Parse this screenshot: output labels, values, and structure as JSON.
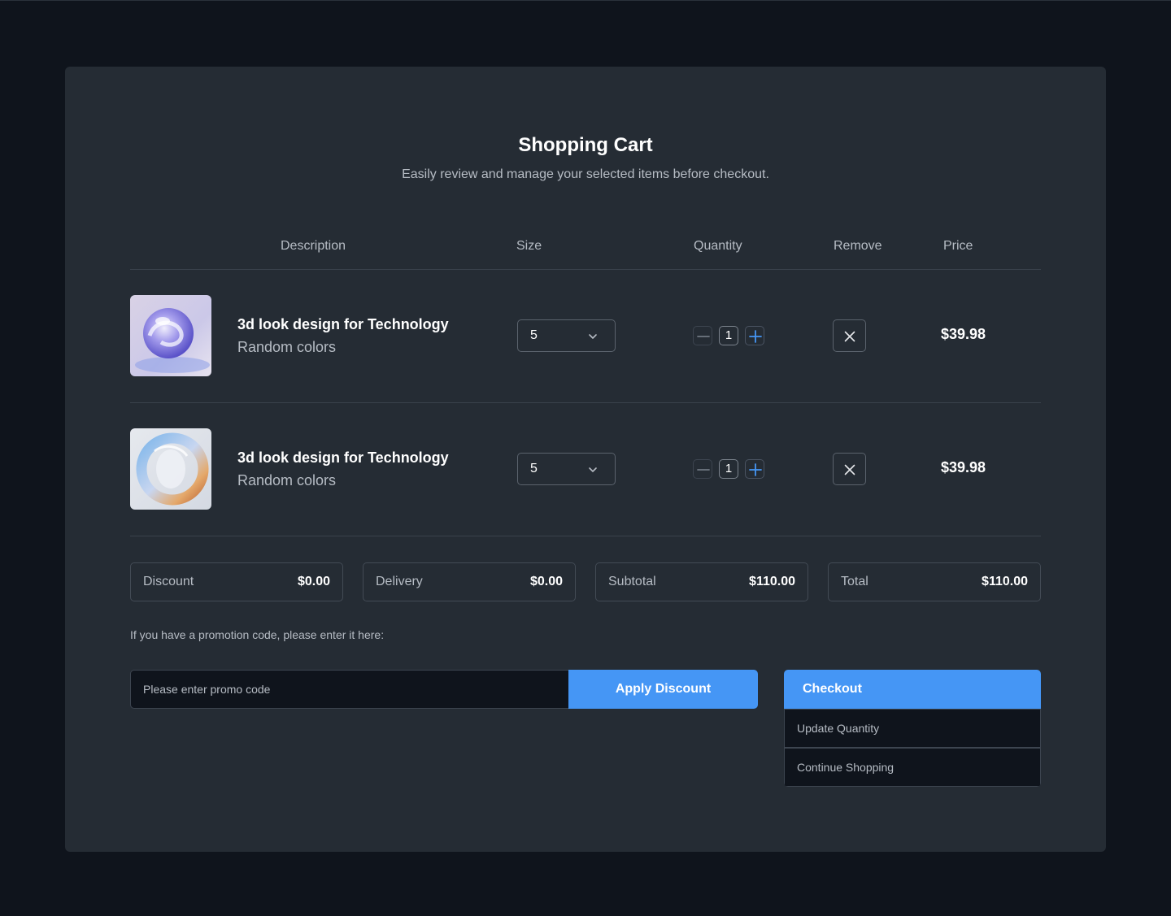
{
  "header": {
    "title": "Shopping Cart",
    "subtitle": "Easily review and manage your selected items before checkout."
  },
  "table": {
    "columns": [
      "Description",
      "Size",
      "Quantity",
      "Remove",
      "Price"
    ]
  },
  "items": [
    {
      "name": "3d look design for Technology",
      "variant": "Random colors",
      "size": "5",
      "quantity": "1",
      "price": "$39.98",
      "thumbnail": "glass-sphere-purple-image"
    },
    {
      "name": "3d look design for Technology",
      "variant": "Random colors",
      "size": "5",
      "quantity": "1",
      "price": "$39.98",
      "thumbnail": "glass-ring-iridescent-image"
    }
  ],
  "summary": [
    {
      "label": "Discount",
      "value": "$0.00"
    },
    {
      "label": "Delivery",
      "value": "$0.00"
    },
    {
      "label": "Subtotal",
      "value": "$110.00"
    },
    {
      "label": "Total",
      "value": "$110.00"
    }
  ],
  "promo": {
    "label": "If you have a promotion code, please enter it here:",
    "placeholder": "Please enter promo code",
    "apply_label": "Apply Discount"
  },
  "actions": {
    "checkout_label": "Checkout",
    "update_label": "Update Quantity",
    "continue_label": "Continue Shopping"
  },
  "colors": {
    "page_bg": "#0f141c",
    "card_bg": "#252c34",
    "accent": "#4596f5",
    "text_primary": "#ffffff",
    "text_secondary": "#b6bcc4"
  },
  "icons": {
    "size_select": "chevron-down-icon",
    "qty_decrease": "minus-icon",
    "qty_increase": "plus-icon",
    "remove": "close-icon"
  }
}
